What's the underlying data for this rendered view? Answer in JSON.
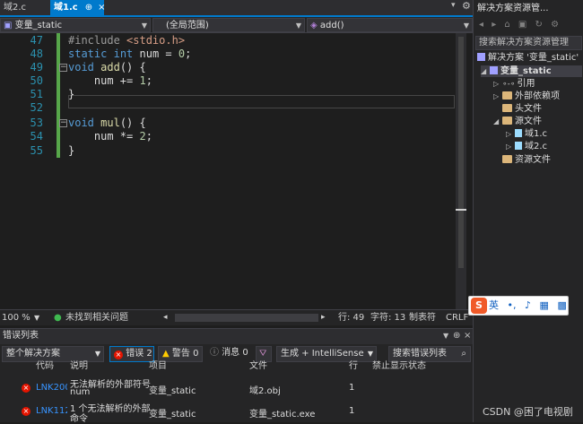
{
  "tabs": [
    {
      "label": "域2.c",
      "active": false
    },
    {
      "label": "域1.c",
      "active": true
    }
  ],
  "tab_pin": "⊕",
  "tab_close": "×",
  "navbar": {
    "project": "变量_static",
    "scope": "(全局范围)",
    "member": "add()"
  },
  "code": {
    "lines": [
      {
        "num": "47"
      },
      {
        "num": "48"
      },
      {
        "num": "49"
      },
      {
        "num": "50"
      },
      {
        "num": "51"
      },
      {
        "num": "52"
      },
      {
        "num": "53"
      },
      {
        "num": "54"
      },
      {
        "num": "55"
      }
    ],
    "l47a": "#include ",
    "l47b": "<stdio.h>",
    "l48a": "static",
    "l48b": " ",
    "l48c": "int",
    "l48d": " num = ",
    "l48e": "0",
    "l48f": ";",
    "l49a": "void",
    "l49b": " ",
    "l49c": "add",
    "l49d": "() {",
    "l50a": "    num += ",
    "l50b": "1",
    "l50c": ";",
    "l51": "}",
    "l53a": "void",
    "l53b": " ",
    "l53c": "mul",
    "l53d": "() {",
    "l54a": "    num *= ",
    "l54b": "2",
    "l54c": ";",
    "l55": "}"
  },
  "status": {
    "zoom": "100 %",
    "issues": "未找到相关问题",
    "line": "行: 49",
    "char": "字符: 13",
    "mode": "制表符",
    "eol": "CRLF"
  },
  "error_list": {
    "title": "错误列表",
    "scope": "整个解决方案",
    "errors": "错误 2",
    "warnings": "警告 0",
    "messages": "消息 0",
    "build": "生成 + IntelliSense",
    "search": "搜索错误列表",
    "columns": [
      "代码",
      "说明",
      "项目",
      "文件",
      "行",
      "禁止显示状态"
    ],
    "rows": [
      {
        "code": "LNK2001",
        "desc1": "无法解析的外部符号",
        "desc2": "num",
        "project": "变量_static",
        "file": "域2.obj",
        "line": "1"
      },
      {
        "code": "LNK1120",
        "desc1": "1 个无法解析的外部",
        "desc2": "命令",
        "project": "变量_static",
        "file": "变量_static.exe",
        "line": "1"
      }
    ]
  },
  "solution_explorer": {
    "title": "解决方案资源管...",
    "search": "搜索解决方案资源管理",
    "items": [
      {
        "label": "解决方案 '变量_static'"
      },
      {
        "label": "变量_static"
      },
      {
        "label": "引用"
      },
      {
        "label": "外部依赖项"
      },
      {
        "label": "头文件"
      },
      {
        "label": "源文件"
      },
      {
        "label": "域1.c"
      },
      {
        "label": "域2.c"
      },
      {
        "label": "资源文件"
      }
    ]
  },
  "ime": {
    "logo": "S",
    "lang": "英"
  },
  "watermark": "CSDN @困了电视剧",
  "colors": {
    "accent": "#007acc",
    "green_change": "#57a64a",
    "error": "#e51400"
  }
}
